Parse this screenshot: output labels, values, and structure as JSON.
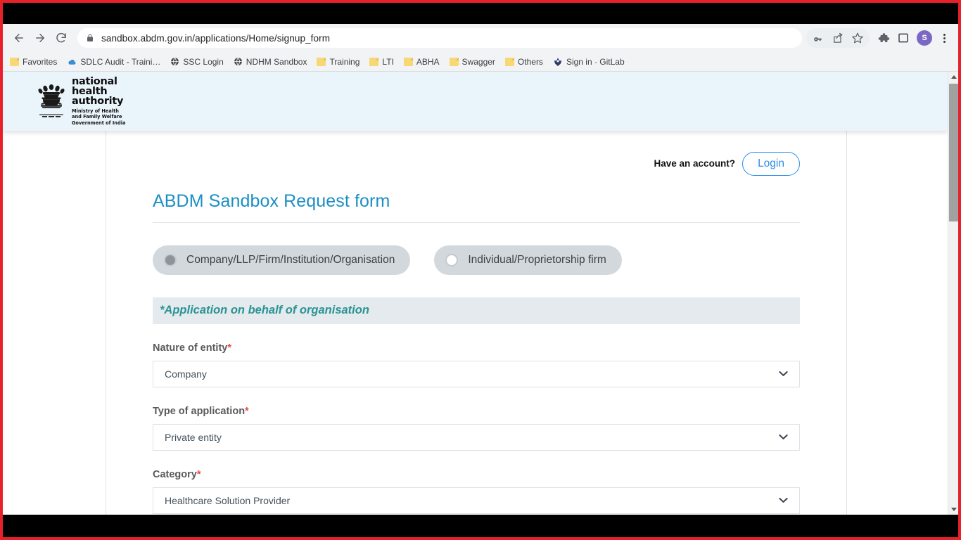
{
  "browser": {
    "url": "sandbox.abdm.gov.in/applications/Home/signup_form",
    "back_label": "Back",
    "forward_label": "Forward",
    "reload_label": "Reload",
    "lock_icon": "lock-icon",
    "toolbar_icons": [
      {
        "name": "password-key-icon",
        "glyph": "key"
      },
      {
        "name": "share-icon",
        "glyph": "share"
      },
      {
        "name": "bookmark-star-icon",
        "glyph": "star"
      },
      {
        "name": "extensions-puzzle-icon",
        "glyph": "puzzle"
      },
      {
        "name": "side-panel-icon",
        "glyph": "panel"
      }
    ],
    "avatar_initial": "S",
    "menu_label": "Customize and control Google Chrome"
  },
  "bookmarks": [
    {
      "label": "Favorites",
      "icon": "folder-icon"
    },
    {
      "label": "SDLC Audit - Traini…",
      "icon": "cloud-icon"
    },
    {
      "label": "SSC Login",
      "icon": "globe-icon"
    },
    {
      "label": "NDHM Sandbox",
      "icon": "globe-icon"
    },
    {
      "label": "Training",
      "icon": "folder-icon"
    },
    {
      "label": "LTI",
      "icon": "folder-icon"
    },
    {
      "label": "ABHA",
      "icon": "folder-icon"
    },
    {
      "label": "Swagger",
      "icon": "folder-icon"
    },
    {
      "label": "Others",
      "icon": "folder-icon"
    },
    {
      "label": "Sign in · GitLab",
      "icon": "gitlab-icon"
    }
  ],
  "site_header": {
    "logo_title_lines": [
      "national",
      "health",
      "authority"
    ],
    "logo_subtitle_lines": [
      "Ministry of Health",
      "and Family Welfare",
      "Government of India"
    ],
    "emblem_alt": "national-emblem-of-india"
  },
  "account": {
    "prompt": "Have an account?",
    "login_label": "Login"
  },
  "form": {
    "title": "ABDM Sandbox Request form",
    "applicant_type": [
      {
        "label": "Company/LLP/Firm/Institution/Organisation",
        "selected": true
      },
      {
        "label": "Individual/Proprietorship firm",
        "selected": false
      }
    ],
    "section_heading": "*Application on behalf of organisation",
    "fields": [
      {
        "label": "Nature of entity",
        "required": "*",
        "value": "Company"
      },
      {
        "label": "Type of application",
        "required": "*",
        "value": "Private entity"
      },
      {
        "label": "Category",
        "required": "*",
        "value": "Healthcare Solution Provider"
      }
    ]
  },
  "colors": {
    "accent_blue": "#1b8fc4",
    "link_blue": "#2b8ce6",
    "teal": "#2a9393",
    "required_red": "#e8473f",
    "header_bg": "#eaf4fb",
    "banner_bg": "#e4eaee",
    "pill_bg": "#d3d8dc"
  }
}
